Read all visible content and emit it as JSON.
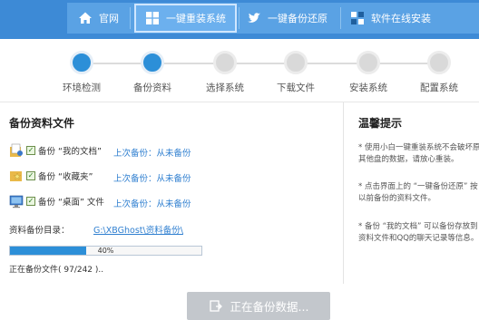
{
  "nav": {
    "items": [
      {
        "label": "官网",
        "icon": "home-icon"
      },
      {
        "label": "一键重装系统",
        "icon": "windows-icon"
      },
      {
        "label": "一键备份还原",
        "icon": "bird-icon"
      },
      {
        "label": "软件在线安装",
        "icon": "app-grid-icon"
      }
    ],
    "active_index": 1
  },
  "steps": {
    "items": [
      "环境检测",
      "备份资料",
      "选择系统",
      "下载文件",
      "安装系统",
      "配置系统"
    ],
    "completed_count": 2
  },
  "backup": {
    "title": "备份资料文件",
    "items": [
      {
        "label": "备份 “我的文档”",
        "last_backup": "上次备份：从未备份",
        "checked": true,
        "icon": "my-documents-icon"
      },
      {
        "label": "备份 “收藏夹”",
        "last_backup": "上次备份：从未备份",
        "checked": true,
        "icon": "favorites-icon"
      },
      {
        "label": "备份 “桌面” 文件",
        "last_backup": "上次备份：从未备份",
        "checked": true,
        "icon": "desktop-icon"
      }
    ],
    "dir_label": "资料备份目录：",
    "dir_path": "G:\\XBGhost\\资料备份\\",
    "progress_percent": 40,
    "progress_text": "40%",
    "status_text": "正在备份文件( 97/242 )..",
    "accent": "#2c8fd8"
  },
  "tips": {
    "title": "温馨提示",
    "items": [
      [
        "* 使用小白一键重装系统不会破坏原",
        "其他盘的数据，请放心重装。"
      ],
      [
        "* 点击界面上的 “一键备份还原” 按",
        "以前备份的资料文件。"
      ],
      [
        "* 备份 “我的文档” 可以备份存放到",
        "资料文件和QQ的聊天记录等信息。"
      ]
    ]
  },
  "button": {
    "label": "正在备份数据...",
    "icon": "backup-icon"
  }
}
